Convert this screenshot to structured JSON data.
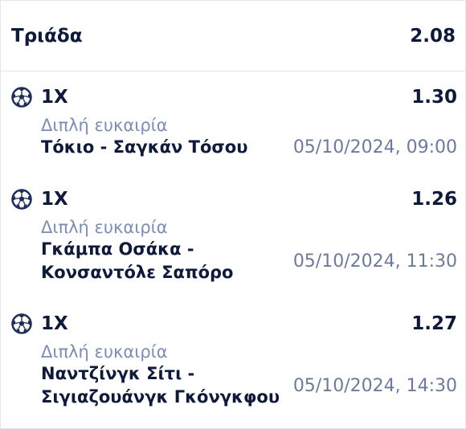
{
  "header": {
    "title": "Τριάδα",
    "total_odds": "2.08"
  },
  "selections": [
    {
      "icon": "soccer-ball-icon",
      "pick": "1X",
      "odds": "1.30",
      "market": "Διπλή ευκαιρία",
      "event_lines": [
        "Τόκιο - Σαγκάν Τόσου"
      ],
      "datetime": "05/10/2024, 09:00"
    },
    {
      "icon": "soccer-ball-icon",
      "pick": "1X",
      "odds": "1.26",
      "market": "Διπλή ευκαιρία",
      "event_lines": [
        "Γκάμπα Οσάκα -",
        "Κονσαντόλε Σαπόρο"
      ],
      "datetime": "05/10/2024, 11:30"
    },
    {
      "icon": "soccer-ball-icon",
      "pick": "1X",
      "odds": "1.27",
      "market": "Διπλή ευκαιρία",
      "event_lines": [
        "Ναντζίνγκ Σίτι -",
        "Σιγιαζουάνγκ Γκόνγκφου"
      ],
      "datetime": "05/10/2024, 14:30"
    }
  ],
  "colors": {
    "primary_text": "#0d1a3a",
    "muted_text": "#7b8db4",
    "ball": "#1f2d5a"
  }
}
